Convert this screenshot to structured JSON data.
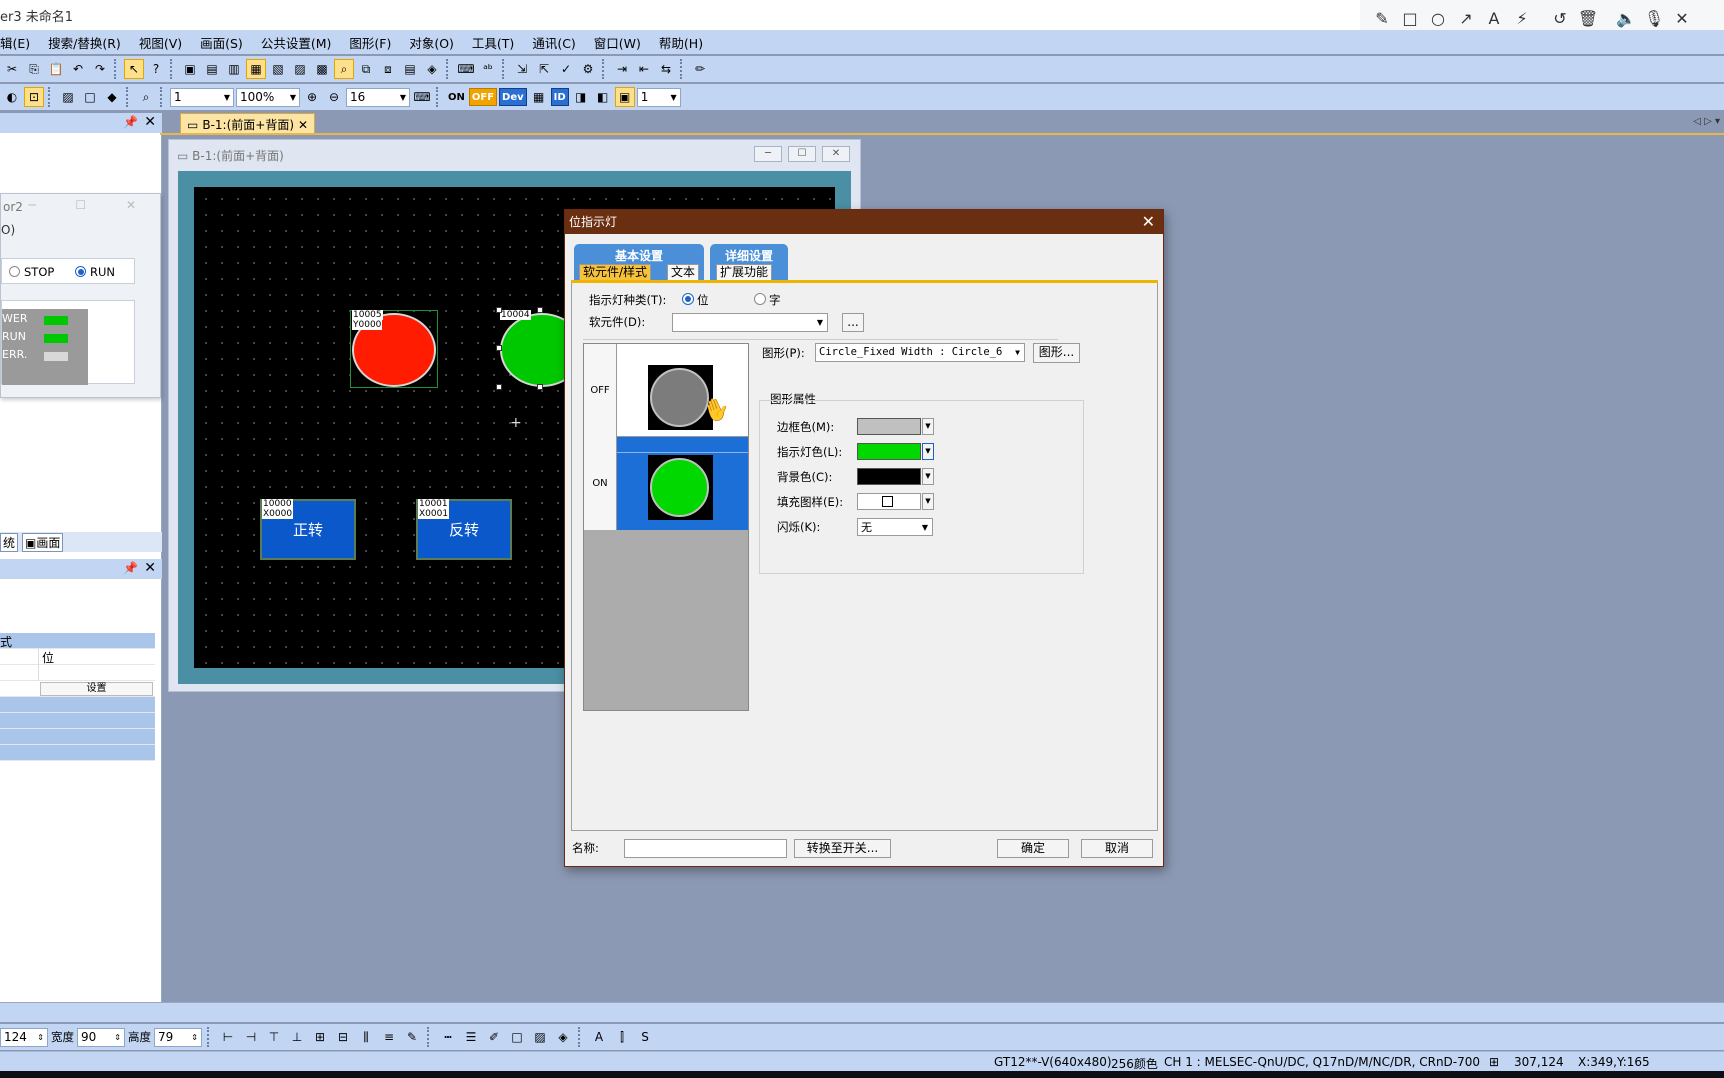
{
  "app": {
    "title": "er3 未命名1"
  },
  "annotation_toolbar": {
    "icons": [
      "pencil-icon",
      "rectangle-icon",
      "circle-icon",
      "arrow-icon",
      "text-icon",
      "magic-wand-icon",
      "undo-icon",
      "trash-icon",
      "speaker-icon",
      "microphone-icon",
      "close-icon"
    ]
  },
  "menu": {
    "items": [
      "辑(E)",
      "搜索/替换(R)",
      "视图(V)",
      "画面(S)",
      "公共设置(M)",
      "图形(F)",
      "对象(O)",
      "工具(T)",
      "通讯(C)",
      "窗口(W)",
      "帮助(H)"
    ]
  },
  "toolbar2": {
    "screen_no": "1",
    "zoom": "100%",
    "grid": "16",
    "on_label": "ON",
    "off_label": "OFF",
    "dev_label": "Dev",
    "id_label": "ID",
    "layer": "1"
  },
  "document_tab": {
    "label": "B-1:(前面+背面)"
  },
  "editor_window": {
    "title": "B-1:(前面+背面)",
    "lamp_red_device": "Y0000",
    "lamp_red_id": "10005",
    "lamp_green_id": "10004",
    "button_fwd": {
      "label": "正转",
      "id": "10000",
      "device": "X0000"
    },
    "button_rev": {
      "label": "反转",
      "id": "10001",
      "device": "X0001"
    }
  },
  "left_panel": {
    "sim_title": "or2",
    "sim_sub": "O)",
    "mode_stop": "STOP",
    "mode_run": "RUN",
    "leds": [
      {
        "label": "WER",
        "color": "#00c800"
      },
      {
        "label": "RUN",
        "color": "#00c800"
      },
      {
        "label": "ERR.",
        "color": "#d8d8d8"
      }
    ],
    "tab_system": "统",
    "tab_screen": "画面",
    "prop_header": "式",
    "prop_value": "位",
    "set_button": "设置"
  },
  "dialog": {
    "title": "位指示灯",
    "tab_basic": "基本设置",
    "tab_basic_sub1": "软元件/样式",
    "tab_basic_sub2": "文本",
    "tab_detail": "详细设置",
    "tab_detail_sub1": "扩展功能",
    "lamp_type_label": "指示灯种类(T):",
    "type_bit": "位",
    "type_word": "字",
    "device_label": "软元件(D):",
    "device_value": "",
    "browse_button": "...",
    "off_label": "OFF",
    "on_label": "ON",
    "shape_label": "图形(P):",
    "shape_value": "Circle_Fixed Width : Circle_6",
    "shape_button": "图形...",
    "props_title": "图形属性",
    "frame_color_label": "边框色(M):",
    "frame_color": "#c0c0c0",
    "lamp_color_label": "指示灯色(L):",
    "lamp_color": "#00d800",
    "bg_color_label": "背景色(C):",
    "bg_color": "#000000",
    "fill_pattern_label": "填充图样(E):",
    "blink_label": "闪烁(K):",
    "blink_value": "无",
    "name_label": "名称:",
    "name_value": "",
    "convert_button": "转换至开关...",
    "ok_button": "确定",
    "cancel_button": "取消"
  },
  "size_toolbar": {
    "x_value": "124",
    "width_label": "宽度",
    "width_value": "90",
    "height_label": "高度",
    "height_value": "79"
  },
  "statusbar": {
    "model": "GT12**-V(640x480)",
    "colors": "256颜色",
    "channel": "CH 1 : MELSEC-QnU/DC, Q17nD/M/NC/DR, CRnD-700",
    "cursor": "307,124",
    "pos": "X:349,Y:165"
  }
}
